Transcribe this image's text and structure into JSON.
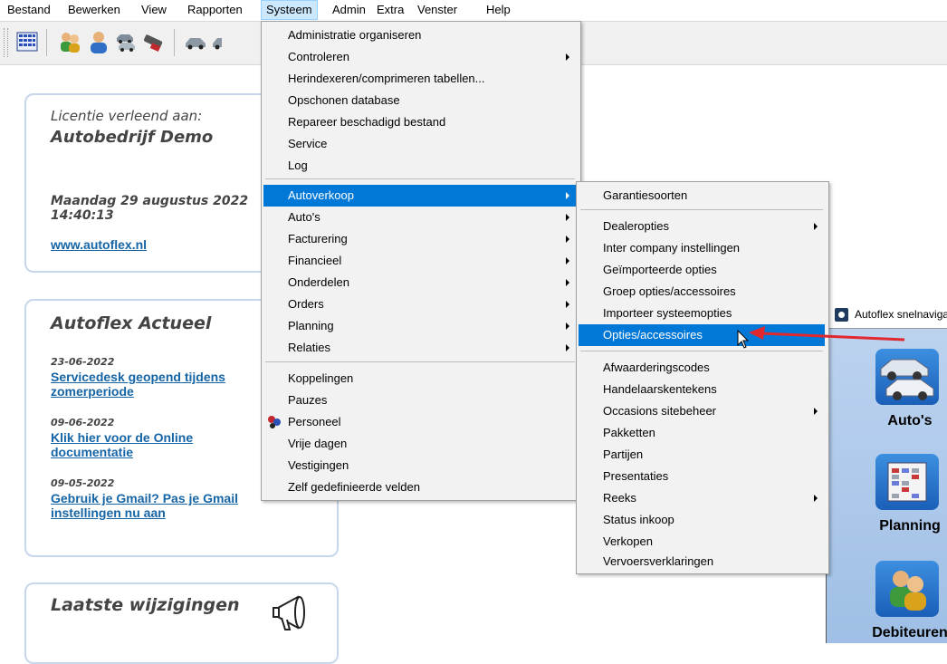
{
  "menubar": {
    "items": [
      {
        "label": "Bestand"
      },
      {
        "label": "Bewerken"
      },
      {
        "label": "View"
      },
      {
        "label": "Rapporten"
      },
      {
        "label": "Systeem",
        "active": true
      },
      {
        "label": "Admin"
      },
      {
        "label": "Extra"
      },
      {
        "label": "Venster"
      },
      {
        "label": "Help"
      }
    ]
  },
  "toolbar": {
    "icons": [
      "grid-icon",
      "users-icon",
      "person-icon",
      "cars-icon",
      "parts-icon",
      "car-icon",
      "car-small-icon"
    ]
  },
  "license": {
    "label": "Licentie verleend aan:",
    "company": "Autobedrijf Demo",
    "datetime_line1": "Maandag 29 augustus 2022",
    "datetime_line2": "14:40:13",
    "website": "www.autoflex.nl"
  },
  "news": {
    "title": "Autoflex Actueel",
    "items": [
      {
        "date": "23-06-2022",
        "line1": "Servicedesk geopend tijdens",
        "line2": "zomerperiode"
      },
      {
        "date": "09-06-2022",
        "line1": "Klik hier voor de Online",
        "line2": "documentatie"
      },
      {
        "date": "09-05-2022",
        "line1": "Gebruik je Gmail? Pas je Gmail",
        "line2": "instellingen nu aan"
      }
    ]
  },
  "changes": {
    "title": "Laatste wijzigingen",
    "icon": "megaphone-icon"
  },
  "systeem_menu": {
    "items": [
      {
        "label": "Administratie organiseren"
      },
      {
        "label": "Controleren",
        "submenu": true
      },
      {
        "label": "Herindexeren/comprimeren tabellen..."
      },
      {
        "label": "Opschonen database"
      },
      {
        "label": "Repareer beschadigd bestand"
      },
      {
        "label": "Service"
      },
      {
        "label": "Log"
      },
      {
        "label": "Autoverkoop",
        "submenu": true,
        "highlighted": true
      },
      {
        "label": "Auto's",
        "submenu": true
      },
      {
        "label": "Facturering",
        "submenu": true
      },
      {
        "label": "Financieel",
        "submenu": true
      },
      {
        "label": "Onderdelen",
        "submenu": true
      },
      {
        "label": "Orders",
        "submenu": true
      },
      {
        "label": "Planning",
        "submenu": true
      },
      {
        "label": "Relaties",
        "submenu": true
      },
      {
        "label": "Koppelingen"
      },
      {
        "label": "Pauzes"
      },
      {
        "label": "Personeel",
        "icon": "personnel-icon"
      },
      {
        "label": "Vrije dagen"
      },
      {
        "label": "Vestigingen"
      },
      {
        "label": "Zelf gedefinieerde velden"
      }
    ]
  },
  "autoverkoop_menu": {
    "items": [
      {
        "label": "Garantiesoorten"
      },
      {
        "label": "Dealeropties",
        "submenu": true
      },
      {
        "label": "Inter company instellingen"
      },
      {
        "label": "Geïmporteerde opties"
      },
      {
        "label": "Groep opties/accessoires"
      },
      {
        "label": "Importeer systeemopties"
      },
      {
        "label": "Opties/accessoires",
        "highlighted": true
      },
      {
        "label": "Afwaarderingscodes"
      },
      {
        "label": "Handelaarskentekens"
      },
      {
        "label": "Occasions sitebeheer",
        "submenu": true
      },
      {
        "label": "Pakketten"
      },
      {
        "label": "Partijen"
      },
      {
        "label": "Presentaties"
      },
      {
        "label": "Reeks",
        "submenu": true
      },
      {
        "label": "Status inkoop"
      },
      {
        "label": "Verkopen"
      },
      {
        "label": "Vervoersverklaringen"
      }
    ]
  },
  "nav_window": {
    "title": "Autoflex snelnavigatie",
    "tiles": [
      {
        "label": "Auto's",
        "icon": "cars-icon"
      },
      {
        "label": "Planning",
        "icon": "calendar-icon"
      },
      {
        "label": "Debiteuren",
        "icon": "people-icon"
      }
    ]
  },
  "colors": {
    "highlight": "#0078d7",
    "link": "#1565a6",
    "panel_border": "#c7d6ec",
    "arrow": "#e0282f"
  }
}
